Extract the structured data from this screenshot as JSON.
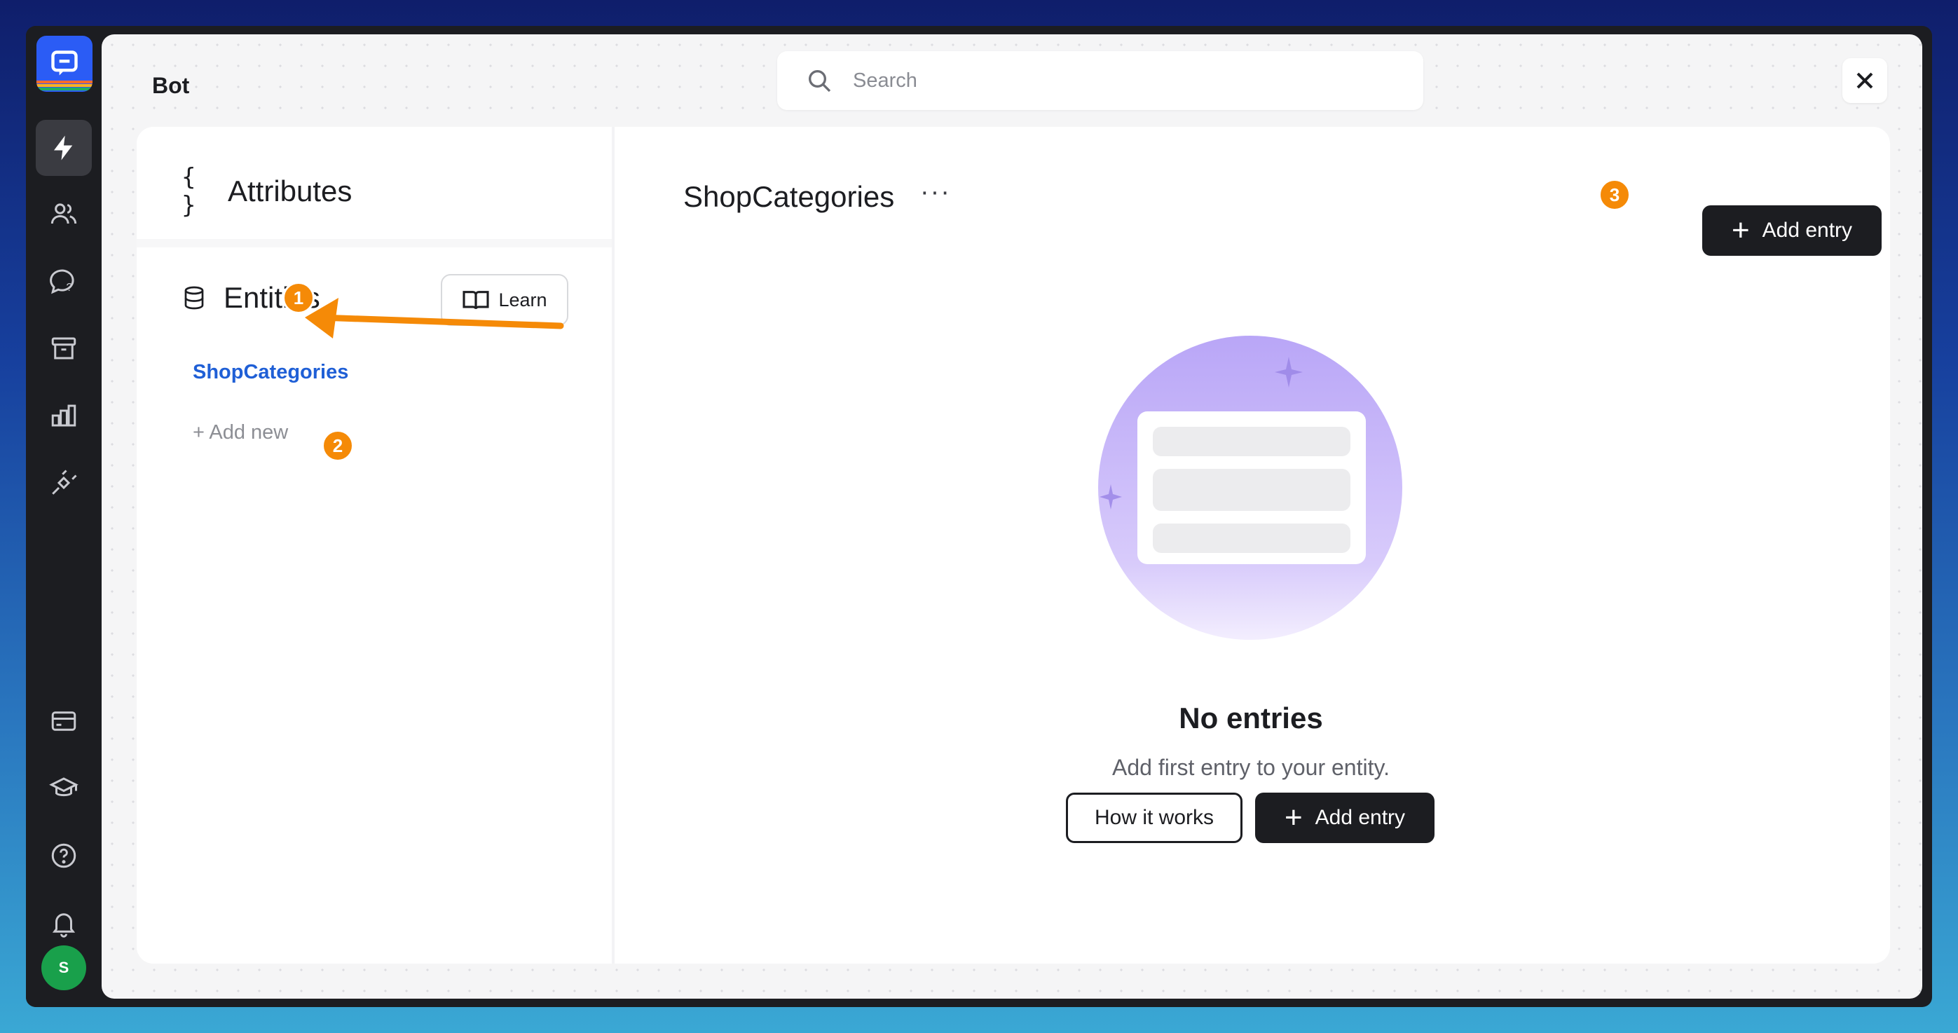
{
  "app": {
    "section_title": "Bot",
    "avatar_initial": "S"
  },
  "search": {
    "placeholder": "Search"
  },
  "sidebar_nav": [
    {
      "name": "automation-icon",
      "active": true
    },
    {
      "name": "customers-icon"
    },
    {
      "name": "chats-icon"
    },
    {
      "name": "archives-icon"
    },
    {
      "name": "reports-icon"
    },
    {
      "name": "integrations-icon"
    },
    {
      "name": "billing-icon"
    },
    {
      "name": "academy-icon"
    },
    {
      "name": "help-icon"
    },
    {
      "name": "notifications-icon"
    }
  ],
  "left_panel": {
    "attributes_icon": "{ }",
    "attributes_label": "Attributes",
    "entities_label": "Entities",
    "learn_label": "Learn",
    "entities": [
      "ShopCategories"
    ],
    "add_new_label": "+ Add new"
  },
  "right_panel": {
    "title": "ShopCategories",
    "more_label": "···",
    "add_entry_label": "Add entry",
    "empty_title": "No entries",
    "empty_subtitle": "Add first entry to your entity.",
    "how_it_works_label": "How it works",
    "add_entry_label_2": "Add entry"
  },
  "annotations": {
    "badge_1": "1",
    "badge_2": "2",
    "badge_3": "3"
  },
  "colors": {
    "accent_blue": "#2b5cf5",
    "link_blue": "#1f5fd6",
    "badge_orange": "#f58a07",
    "dark_button": "#1c1d21",
    "avatar_green": "#19a04b"
  }
}
